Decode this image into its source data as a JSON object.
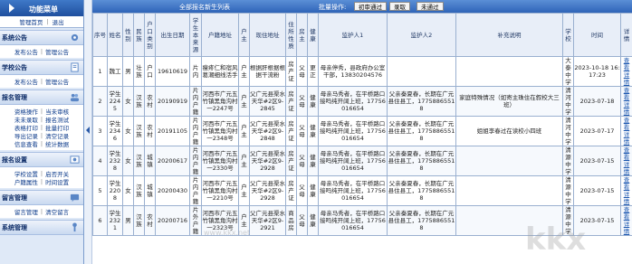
{
  "sidebar": {
    "title": "功能菜单",
    "top_links": [
      "管理首页",
      "退出"
    ],
    "sections": [
      {
        "title": "系统公告",
        "items": [
          "发布公告",
          "管理公告"
        ]
      },
      {
        "title": "学校公告",
        "items": [
          "发布公告",
          "管理公告"
        ]
      },
      {
        "title": "报名管理",
        "items": [
          "资格操作",
          "当未审核",
          "未未录取",
          "报名测试",
          "表格打印",
          "批量打印",
          "导出记录",
          "清空记录",
          "信息查看",
          "统计数据"
        ]
      },
      {
        "title": "报名设置",
        "items": [
          "学校设置",
          "启否开关",
          "户籍属性",
          "时间设置"
        ]
      },
      {
        "title": "留言管理",
        "items": [
          "留言管理",
          "清空留言"
        ]
      },
      {
        "title": "系统管理",
        "items": []
      }
    ]
  },
  "toolbar": {
    "title": "全部报名新生列表",
    "batch_label": "批量操作:",
    "btn_first_pass": "初审通过",
    "btn_admit": "录取",
    "btn_fail": "未通过"
  },
  "table": {
    "headers": [
      "序号",
      "姓名",
      "性别",
      "民族",
      "户口类别",
      "出生日期",
      "学生本来源",
      "户籍地址",
      "户主",
      "现住地址",
      "住所性质",
      "房主",
      "健康",
      "监护人1",
      "监护人2",
      "补充说明",
      "学校",
      "时间",
      "详情"
    ],
    "rows": [
      [
        "1",
        "魏工",
        "男",
        "壮族",
        "户口",
        "19610619",
        "片内",
        "瘦疼仁和宿风葛潮细线活手",
        "户主",
        "根据肝根据根据干流粉",
        "房产证",
        "父母",
        "更正",
        "母亲停秀，县政府办公室干部，13830204576",
        "",
        "",
        "大泰中学",
        "2023-10-18 16:17:23",
        "查看详情"
      ],
      [
        "2",
        "学生2245",
        "女",
        "汉族",
        "农村",
        "20190919",
        "片内户籍",
        "河西市广元五竹镇黑角沟村一2247号",
        "户主",
        "父广元县渠水天华#2区9-2845",
        "房产证",
        "父母",
        "健康",
        "母亲马秀者，在平桥路口接吗纯开阔上班，17756016654",
        "父亲秦夏春，长期在广元县住县工，17758865518",
        "家庭特殊情况（如寄主珠住在叙校大三班）",
        "清河中学",
        "2023-07-18",
        "查看详情"
      ],
      [
        "3",
        "学生2346",
        "女",
        "汉族",
        "农村",
        "20191105",
        "片内户籍",
        "河西市广元五竹镇黑角沟村一2348号",
        "户主",
        "父广元县渠水天华#2区9-2848",
        "房产证",
        "父母",
        "健康",
        "母亲马秀者，在平桥路口接吗纯开阔上班，17756016654",
        "父亲秦夏春，长期在广元县住县工，17758865518",
        "姐姐李春过在读校小四班",
        "清河中学",
        "2023-07-17",
        "查看详情"
      ],
      [
        "4",
        "学生2328",
        "女",
        "汉族",
        "城镇",
        "20200617",
        "片内户籍",
        "河西市广元五竹镇黑角沟村一2330号",
        "户主",
        "父广元县渠水天华#2区9-2928",
        "房产证",
        "父母",
        "健康",
        "母亲马秀者，在平桥路口接吗纯开阔上班，17756016654",
        "父亲秦夏春，长期在广元县住县工，17758865518",
        "",
        "清源中学",
        "2023-07-15",
        "查看详情"
      ],
      [
        "5",
        "学生2208",
        "女",
        "汉族",
        "城镇",
        "20200430",
        "片内户籍",
        "河西市广元五竹镇黑角沟村一2210号",
        "户主",
        "父广元县渠水天华#2区9-2928",
        "房产证",
        "父母",
        "健康",
        "母亲马秀者，在平桥路口接吗纯开阔上班，17756016654",
        "父亲秦夏春，长期在广元县住县工，17758865518",
        "",
        "清源中学",
        "2023-07-15",
        "查看详情"
      ],
      [
        "6",
        "学生2321",
        "男",
        "汉族",
        "农村",
        "20200716",
        "片外户籍",
        "河西市广元五竹镇黑角沟村一2323号",
        "户主",
        "父广元县渠水天华#2区9-2921",
        "商品房",
        "父母",
        "健康",
        "母亲马秀者，在平桥路口接吗纯开阔上班，17756016654",
        "父亲秦夏春，长期在广元县住县工，17758865518",
        "",
        "清源中学",
        "2023-07-15",
        "查看详情"
      ]
    ]
  },
  "watermark": {
    "brand": "kkx",
    "domain_text": "www.kkx.net"
  }
}
